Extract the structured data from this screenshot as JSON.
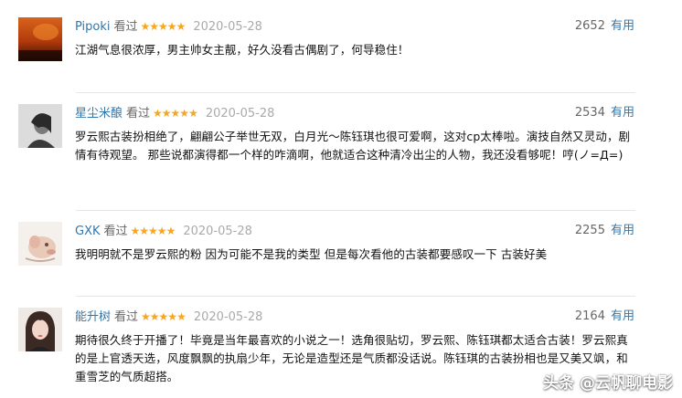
{
  "colors": {
    "username": "#3377aa",
    "star": "#f5a623",
    "date": "#aaaaaa",
    "text": "#111111"
  },
  "reviews": [
    {
      "user": "Pipoki",
      "status": "看过",
      "stars": "★★★★★",
      "rating": 5,
      "date": "2020-05-28",
      "votes": "2652",
      "useful_label": "有用",
      "content": "江湖气息很浓厚，男主帅女主靓，好久没看古偶剧了，何导稳住！"
    },
    {
      "user": "星尘米酿",
      "status": "看过",
      "stars": "★★★★★",
      "rating": 5,
      "date": "2020-05-28",
      "votes": "2534",
      "useful_label": "有用",
      "content": "罗云熙古装扮相绝了，翩翩公子举世无双，白月光～陈钰琪也很可爱啊，这对cp太棒啦。演技自然又灵动，剧情有待观望。 那些说都演得都一个样的咋滴啊，他就适合这种清冷出尘的人物，我还没看够呢！哼(ノ=Д=)"
    },
    {
      "user": "GXK",
      "status": "看过",
      "stars": "★★★★★",
      "rating": 5,
      "date": "2020-05-28",
      "votes": "2255",
      "useful_label": "有用",
      "content": "我明明就不是罗云熙的粉 因为可能不是我的类型 但是每次看他的古装都要感叹一下 古装好美"
    },
    {
      "user": "能升树",
      "status": "看过",
      "stars": "★★★★★",
      "rating": 5,
      "date": "2020-05-28",
      "votes": "2164",
      "useful_label": "有用",
      "content": "期待很久终于开播了！毕竟是当年最喜欢的小说之一！选角很贴切，罗云熙、陈钰琪都太适合古装！罗云熙真的是上官透天选，风度飘飘的执扇少年，无论是造型还是气质都没话说。陈钰琪的古装扮相也是又美又飒，和重雪芝的气质超搭。"
    }
  ],
  "watermark": "头条 @云帆聊电影"
}
